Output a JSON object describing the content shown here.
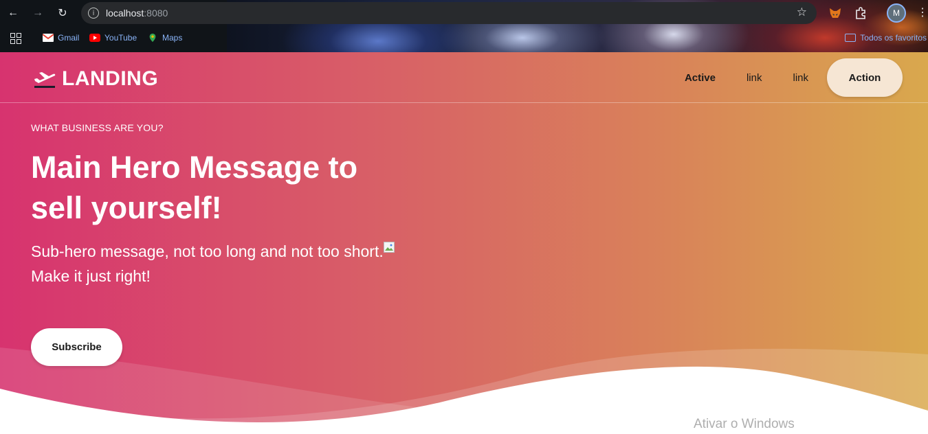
{
  "browser": {
    "url_host": "localhost",
    "url_port": ":8080",
    "profile_initial": "M",
    "bookmarks": [
      {
        "label": "Gmail",
        "icon": "gmail-icon"
      },
      {
        "label": "YouTube",
        "icon": "youtube-icon"
      },
      {
        "label": "Maps",
        "icon": "maps-icon"
      }
    ],
    "all_bookmarks_label": "Todos os favoritos"
  },
  "landing": {
    "brand": "LANDING",
    "nav": {
      "active": "Active",
      "link1": "link",
      "link2": "link",
      "action": "Action"
    },
    "eyebrow": "WHAT BUSINESS ARE YOU?",
    "hero_title": "Main Hero Message to sell yourself!",
    "hero_sub_1": "Sub-hero message, not too long and not too short.",
    "hero_sub_2": "Make it just right!",
    "subscribe": "Subscribe"
  },
  "os_watermark": "Ativar o Windows",
  "colors": {
    "gradient_start": "#d7336f",
    "gradient_end": "#d9a84d",
    "action_bg": "#f6e6d4"
  }
}
